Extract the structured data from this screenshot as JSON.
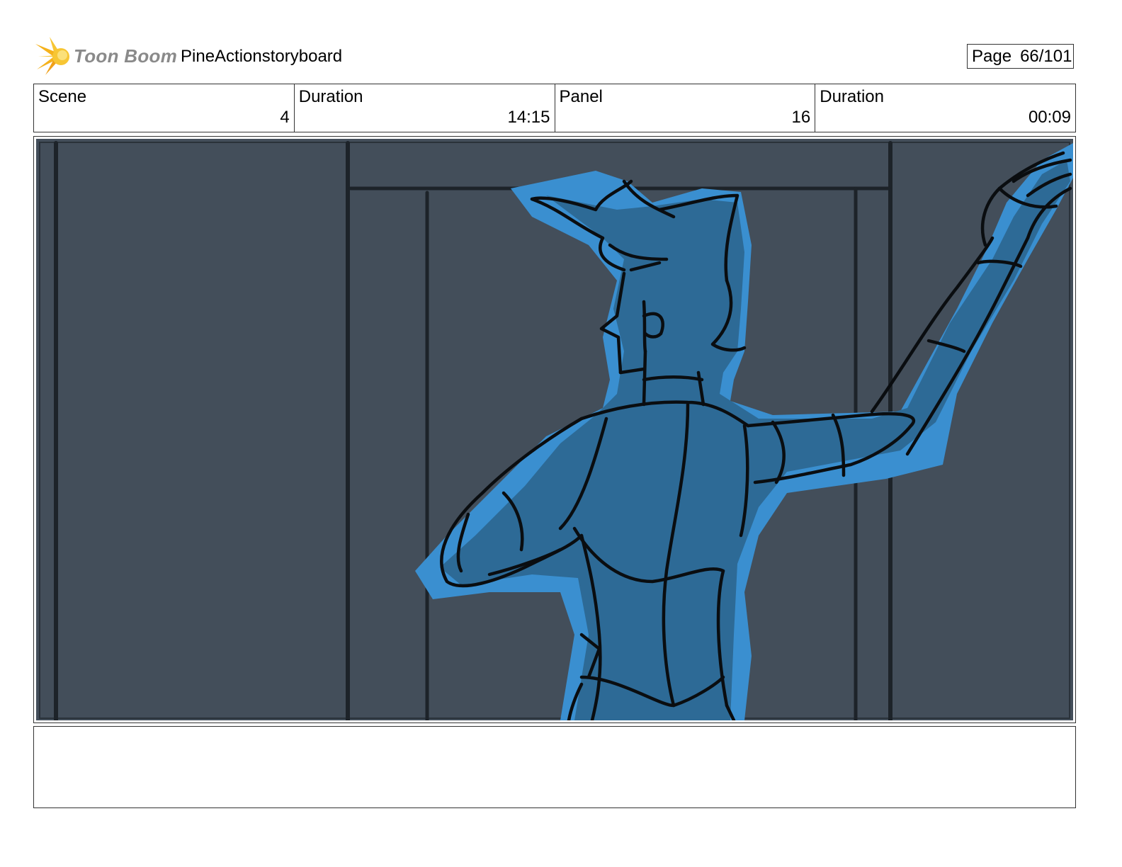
{
  "header": {
    "logo_text": "Toon Boom",
    "title": "PineActionstoryboard",
    "page_label": "Page",
    "page_value": "66/101"
  },
  "info": [
    {
      "label": "Scene",
      "value": "4"
    },
    {
      "label": "Duration",
      "value": "14:15"
    },
    {
      "label": "Panel",
      "value": "16"
    },
    {
      "label": "Duration",
      "value": "00:09"
    }
  ],
  "panel": {
    "background_color": "#434e5a",
    "character_fill": "#2d6a96",
    "character_halo": "#3a8fd0"
  },
  "notes": {
    "text": ""
  }
}
